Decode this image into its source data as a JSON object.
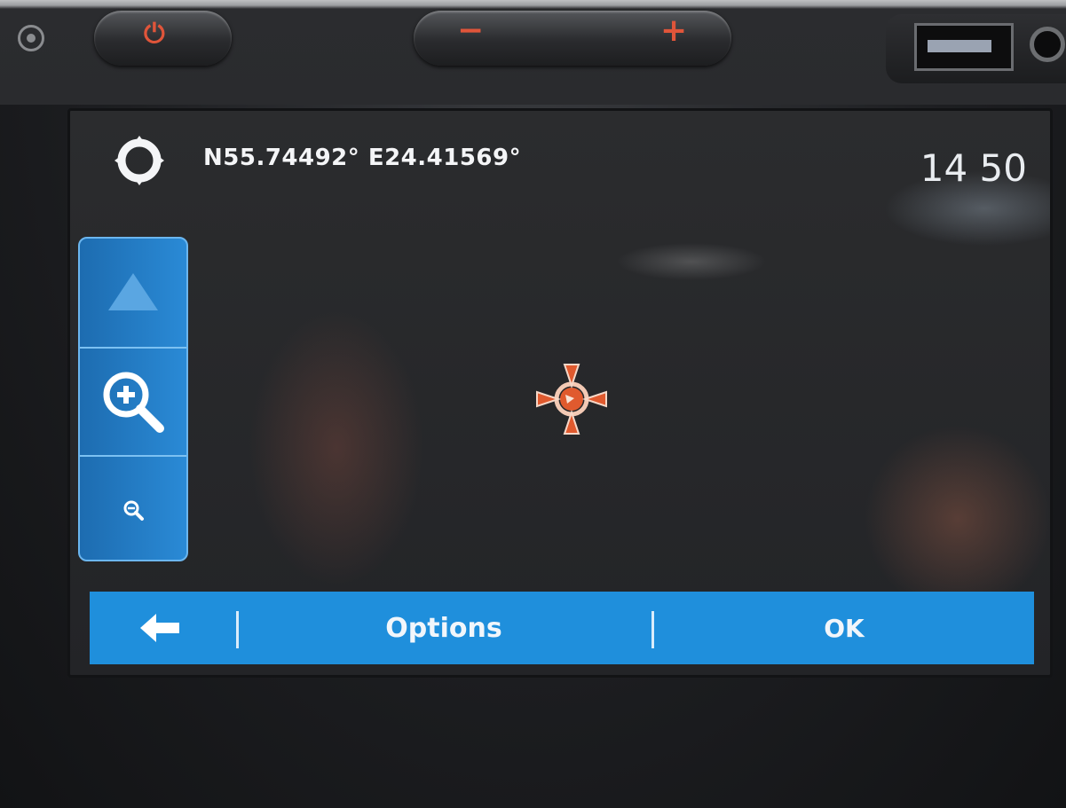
{
  "status": {
    "coordinates": "N55.74492° E24.41569°",
    "time": "14 50"
  },
  "map_controls": {
    "items": [
      {
        "name": "north-arrow",
        "icon": "north-arrow-icon"
      },
      {
        "name": "zoom-in",
        "icon": "zoom-in-icon"
      },
      {
        "name": "zoom-out",
        "icon": "zoom-out-icon"
      }
    ]
  },
  "bottom_bar": {
    "back_icon": "back-arrow-icon",
    "options_label": "Options",
    "ok_label": "OK"
  },
  "colors": {
    "accent": "#1f8fdc",
    "crosshair": "#e05a2e",
    "text": "#f4f5f7"
  }
}
